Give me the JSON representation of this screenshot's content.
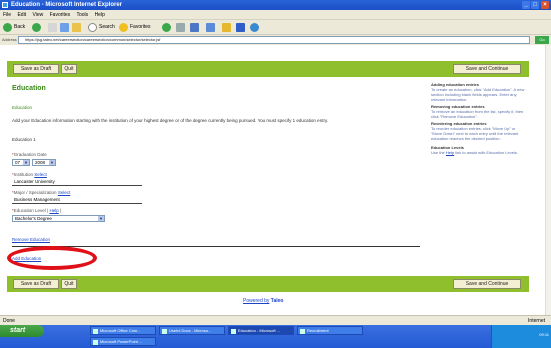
{
  "window": {
    "title": "Education - Microsoft Internet Explorer"
  },
  "menubar": [
    "File",
    "Edit",
    "View",
    "Favorites",
    "Tools",
    "Help"
  ],
  "toolbar": {
    "back_label": "Back",
    "search_label": "Search",
    "favorites_label": "Favorites"
  },
  "addressbar": {
    "label": "Address",
    "url": "https://jsg.taleo.net/careersection/careersection/common/selector/selector.jsf",
    "go_label": "Go"
  },
  "page": {
    "buttons": {
      "save_as_draft": "Save as Draft",
      "quit": "Quit",
      "save_and_continue": "Save and Continue"
    },
    "heading": "Education",
    "subheading": "Education",
    "instructions": "Add your Education information starting with the institution of your highest degree or of the degree currently being pursued. You must specify 1 education entry.",
    "entry_title": "Education 1",
    "graduation_date": {
      "label": "Graduation Date",
      "month": "07",
      "year": "2008"
    },
    "institution": {
      "label": "Institution",
      "select_link": "Select",
      "value": "Lancaster University"
    },
    "major": {
      "label": "Major / Specialization",
      "select_link": "Select",
      "value": "Business Management"
    },
    "education_level": {
      "label": "Education Level",
      "help_link": "Help",
      "value": "Bachelor's Degree"
    },
    "remove_link": "Remove Education",
    "add_link": "Add Education",
    "footer": {
      "powered_by": "Powered by",
      "brand": "Taleo"
    }
  },
  "sidebar": {
    "sections": [
      {
        "heading": "Adding education entries",
        "body": "To create an education, click \"Add Education\". A new section including blank fields appears. Enter any relevant information."
      },
      {
        "heading": "Removing education entries",
        "body": "To remove an education from the list, specify it, then click \"Remove Education\"."
      },
      {
        "heading": "Reordering education entries",
        "body": "To reorder education entries, click \"Move Up\" or \"Move Down\" next to each entry until the relevant education reaches the desired position."
      },
      {
        "heading": "Education Levels",
        "body_prefix": "Use the",
        "help_link": "Help",
        "body_suffix": "link to assist with Education Levels."
      }
    ]
  },
  "statusbar": {
    "left": "Done",
    "right": "Internet"
  },
  "taskbar": {
    "start": "start",
    "tasks": [
      "Microsoft Office Com...",
      "Useful Docs - Microso...",
      "Education - Microsoft ...",
      "Recruitment",
      "Microsoft PowerPoint ..."
    ],
    "clock": "09:11"
  },
  "colors": {
    "accent_green": "#8fbf2c",
    "heading_green": "#3b8a1a",
    "link_blue": "#1b45c6",
    "highlight_red": "#e01018"
  }
}
